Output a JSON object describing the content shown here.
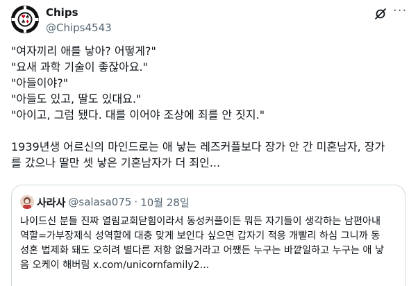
{
  "author": {
    "display_name": "Chips",
    "handle": "@Chips4543"
  },
  "icons": {
    "grok": "grok-icon",
    "more": "more-icon"
  },
  "tweet": {
    "lines": [
      "\"여자끼리 애를 낳아? 어떻게?\"",
      "\"요새 과학 기술이 좋잖아요.\"",
      "\"아들이야?\"",
      "\"아들도 있고, 딸도 있대요.\"",
      "\"아이고, 그럼 됐다. 대를 이어야 조상에 죄를 안 짓지.\"",
      "1939년생 어르신의 마인드로는 애 낳는 레즈커플보다 장가 안 간 미혼남자, 장가",
      "를 갔으나 딸만 셋 낳은 기혼남자가 더 죄인..."
    ]
  },
  "quote": {
    "display_name": "사라사",
    "handle": "@salasa075",
    "separator": "·",
    "date": "10월 28일",
    "lines": [
      "나이드신 분들 진짜 열림교회닫힘이라서 동성커플이든 뭐든 자기들이 생각하는 남편아내",
      "역할=가부장제식 성역할에 대충 맞게 보인다 싶으면 갑자기 적응 개빨리 하심 그니까 동",
      "성혼 법제화 돼도 오히려 별다른 저항 없을거라고 어쨌든 누구는 바깥일하고 누구는 애 낳",
      "음 오케이 해버림 x.com/unicornfamily2..."
    ]
  },
  "colors": {
    "text": "#0f1419",
    "secondary": "#536471",
    "border": "#cfd9de",
    "background": "#ffffff"
  }
}
